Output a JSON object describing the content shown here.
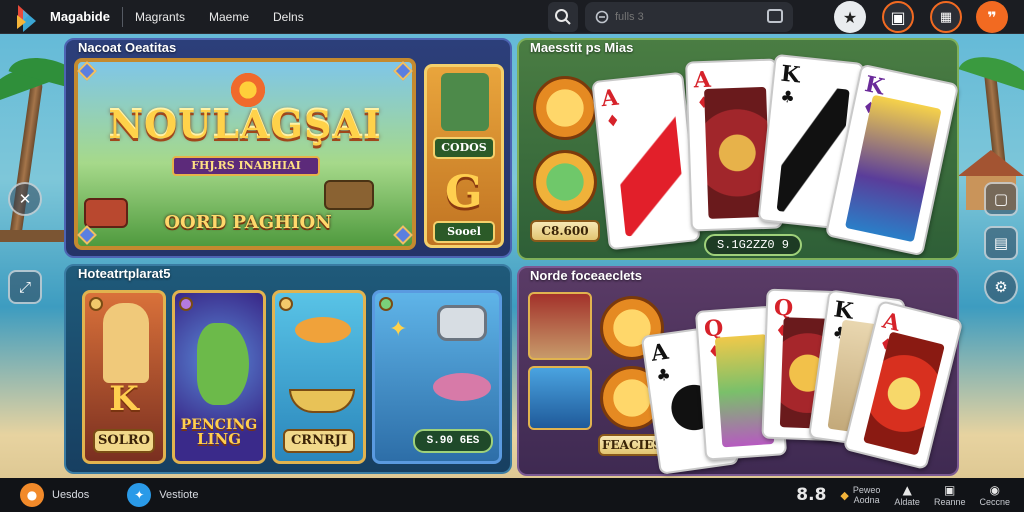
{
  "topbar": {
    "brand": "Magabide",
    "nav": [
      "Magrants",
      "Maeme",
      "Delns"
    ],
    "search_placeholder": "fulls 3",
    "icons": [
      "search-icon",
      "star-icon",
      "cart-icon",
      "calendar-icon",
      "quote-icon"
    ]
  },
  "panels": {
    "top_left": {
      "title": "Nacoat Oeatitas",
      "hero_title": "NOULAGŞAI",
      "hero_subtitle": "FHJ.RS INABHIAI",
      "hero_cta": "OORD PAGHION",
      "side_label_1": "CODOS",
      "side_big_letter": "G",
      "side_label_2": "Sooel"
    },
    "top_right": {
      "title": "Maesstit ps Mias",
      "coin_button": "C8.600",
      "caption": "S.1G2ZZ0 9",
      "cards": [
        {
          "rank": "A",
          "suit": "♦",
          "color": "red"
        },
        {
          "rank": "A",
          "suit": "♦",
          "color": "red"
        },
        {
          "rank": "K",
          "suit": "♣",
          "color": "blk"
        },
        {
          "rank": "K",
          "suit": "♦",
          "color": "purple"
        }
      ]
    },
    "bottom_left": {
      "title": "Hoteatrtplarat5",
      "tiles": [
        {
          "big": "K",
          "label": "SOLRO"
        },
        {
          "big": "PENCING",
          "label": "LING"
        },
        {
          "big": "",
          "label": "CRNRJI"
        },
        {
          "big": "",
          "label": "S.90 6ES"
        }
      ]
    },
    "bottom_right": {
      "title": "Norde foceaeclets",
      "coin_label": "FEACIES",
      "cards": [
        {
          "rank": "A",
          "suit": "♣",
          "color": "blk"
        },
        {
          "rank": "Q",
          "suit": "♦",
          "color": "red"
        },
        {
          "rank": "Q",
          "suit": "♦",
          "color": "red"
        },
        {
          "rank": "K",
          "suit": "♣",
          "color": "blk"
        },
        {
          "rank": "A",
          "suit": "♦",
          "color": "red"
        }
      ]
    }
  },
  "bottombar": {
    "left": [
      {
        "icon": "chat-icon",
        "label": "Uesdos"
      },
      {
        "icon": "bird-icon",
        "label": "Vestiote"
      }
    ],
    "score": "8.8",
    "items": [
      {
        "top": "Peweo",
        "bottom": "Aodna"
      },
      {
        "top": "",
        "bottom": "Aldate"
      },
      {
        "top": "",
        "bottom": "Reanne"
      },
      {
        "top": "",
        "bottom": "Ceccne"
      }
    ]
  },
  "colors": {
    "topbar_bg": "#1b1d22",
    "accent_orange": "#f26a21",
    "gold": "#e1b34f"
  }
}
